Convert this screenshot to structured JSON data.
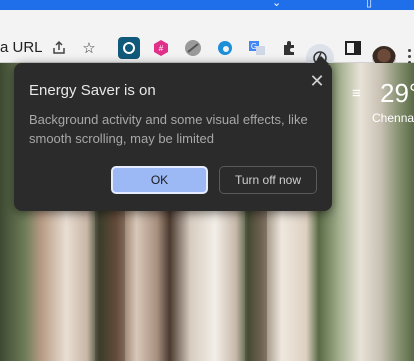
{
  "toolbar": {
    "url_fragment": "a URL",
    "extensions": [
      {
        "name": "share-icon",
        "glyph": "⇪"
      },
      {
        "name": "bookmark-star-icon",
        "glyph": "☆"
      }
    ]
  },
  "popup": {
    "title": "Energy Saver is on",
    "body": "Background activity and some visual effects, like smooth scrolling, may be limited",
    "ok_label": "OK",
    "turn_off_label": "Turn off now",
    "close_glyph": "✕"
  },
  "weather": {
    "menu_glyph": "≡",
    "temperature": "29°",
    "city": "Chenna"
  },
  "colors": {
    "popup_bg": "#2b2b2b",
    "ok_button": "#9cb8f5",
    "accent": "#1f6feb"
  }
}
